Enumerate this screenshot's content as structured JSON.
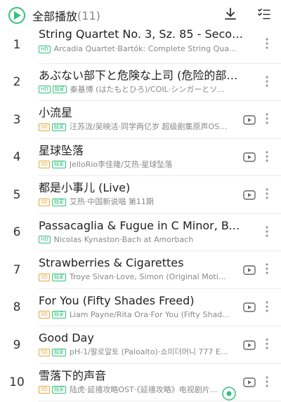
{
  "header": {
    "play_all_label": "全部播放",
    "count_label": "(11)",
    "accent_color": "#31c27c"
  },
  "songs": [
    {
      "num": "1",
      "title": "String Quartet No. 3, Sz. 85 - Seconda p...",
      "badges": [
        "HD"
      ],
      "sub": "Arcadia Quartet·Bartók: Complete String Qua...",
      "mv": false
    },
    {
      "num": "2",
      "title": "あぶない部下と危険な上司 (危险的部下...",
      "badges": [
        "HD",
        "独家"
      ],
      "sub": "秦基博 (はたもとひろ)/COIL·シンガーとソ...",
      "mv": false
    },
    {
      "num": "3",
      "title": "小流星",
      "badges": [
        "SD",
        "独家"
      ],
      "sub": "汪苏泷/吴映洁·同学两亿岁 超级剧集原声OST·《...",
      "mv": true
    },
    {
      "num": "4",
      "title": "星球坠落",
      "badges": [
        "SD",
        "独家"
      ],
      "sub": "JelloRio李佳隆/艾热·星球坠落",
      "mv": true
    },
    {
      "num": "5",
      "title": "都是小事儿 (Live)",
      "badges": [
        "SD",
        "独家"
      ],
      "sub": "艾热·中国新说唱 第11期",
      "mv": true
    },
    {
      "num": "6",
      "title": "Passacaglia & Fugue in C Minor, BWV 5...",
      "badges": [
        "HD"
      ],
      "sub": "Nicolas Kynaston·Bach at Amorbach",
      "mv": false
    },
    {
      "num": "7",
      "title": "Strawberries & Cigarettes",
      "badges": [
        "SD",
        "独家"
      ],
      "sub": "Troye Sivan·Love, Simon (Original Motion...",
      "mv": true
    },
    {
      "num": "8",
      "title": "For You (Fifty Shades Freed)",
      "badges": [
        "SD",
        "独家"
      ],
      "sub": "Liam Payne/Rita Ora·For You (Fifty Shad...",
      "mv": true
    },
    {
      "num": "9",
      "title": "Good Day",
      "badges": [
        "SD",
        "独家"
      ],
      "sub": "pH-1/팔로알토 (Paloalto)·쇼미더머니 777 E...",
      "mv": true
    },
    {
      "num": "10",
      "title": "雪落下的声音",
      "badges": [
        "SD",
        "独家"
      ],
      "sub": "陆虎·延禧攻略OST·《延禧攻略》电视剧片...",
      "mv": true
    }
  ],
  "icons": {
    "play": "play-icon",
    "download": "download-icon",
    "multi_select": "multi-select-icon",
    "mv": "mv-icon",
    "more": "more-vertical-icon",
    "float": "recognize-icon"
  }
}
